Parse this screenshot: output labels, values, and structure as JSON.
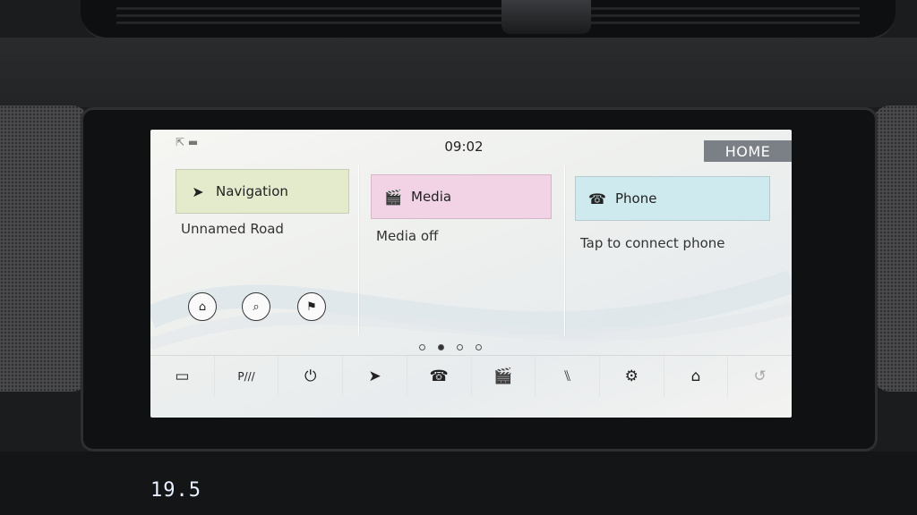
{
  "status": {
    "time": "09:02",
    "home_label": "HOME",
    "signal_icon": "signal-status-icon"
  },
  "navigation": {
    "title": "Navigation",
    "subtitle": "Unnamed Road",
    "icon": "navigation-arrow-icon",
    "quick_actions": [
      {
        "name": "nav-home-icon",
        "glyph": "⌂"
      },
      {
        "name": "nav-search-icon",
        "glyph": "⌕"
      },
      {
        "name": "nav-destination-flag-icon",
        "glyph": "⚑"
      }
    ]
  },
  "media": {
    "title": "Media",
    "subtitle": "Media off",
    "icon": "clapperboard-icon"
  },
  "phone": {
    "title": "Phone",
    "subtitle": "Tap to connect phone",
    "icon": "telephone-icon"
  },
  "pager": {
    "pages": 4,
    "active_index": 1
  },
  "dock": [
    {
      "name": "camera-icon",
      "glyph": "▭"
    },
    {
      "name": "parking-aid-icon",
      "glyph": "P"
    },
    {
      "name": "power-icon",
      "glyph": "⏻"
    },
    {
      "name": "navigation-icon",
      "glyph": "➤"
    },
    {
      "name": "phone-icon",
      "glyph": "☎"
    },
    {
      "name": "media-icon",
      "glyph": "🎬"
    },
    {
      "name": "seat-icon",
      "glyph": "⑊"
    },
    {
      "name": "settings-icon",
      "glyph": "⚙"
    },
    {
      "name": "home-icon",
      "glyph": "⌂"
    },
    {
      "name": "back-icon",
      "glyph": "↺"
    }
  ],
  "dashboard": {
    "temperature": "19.5"
  }
}
